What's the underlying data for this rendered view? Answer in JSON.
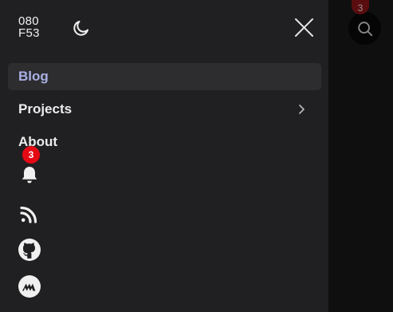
{
  "header": {
    "logo_line1": "080",
    "logo_line2": "F53"
  },
  "nav": {
    "items": [
      {
        "label": "Blog",
        "active": true
      },
      {
        "label": "Projects",
        "has_submenu": true
      },
      {
        "label": "About"
      }
    ]
  },
  "notifications": {
    "count": "3"
  },
  "background": {
    "badge_count": "3"
  },
  "icons": [
    "moon-icon",
    "close-icon",
    "chevron-right-icon",
    "bell-icon",
    "rss-icon",
    "github-icon",
    "medium-icon",
    "search-icon"
  ],
  "colors": {
    "drawer_bg": "#202022",
    "active_item_bg": "#2d2d30",
    "active_item_text": "#a9b0e3",
    "badge": "#e50914"
  }
}
